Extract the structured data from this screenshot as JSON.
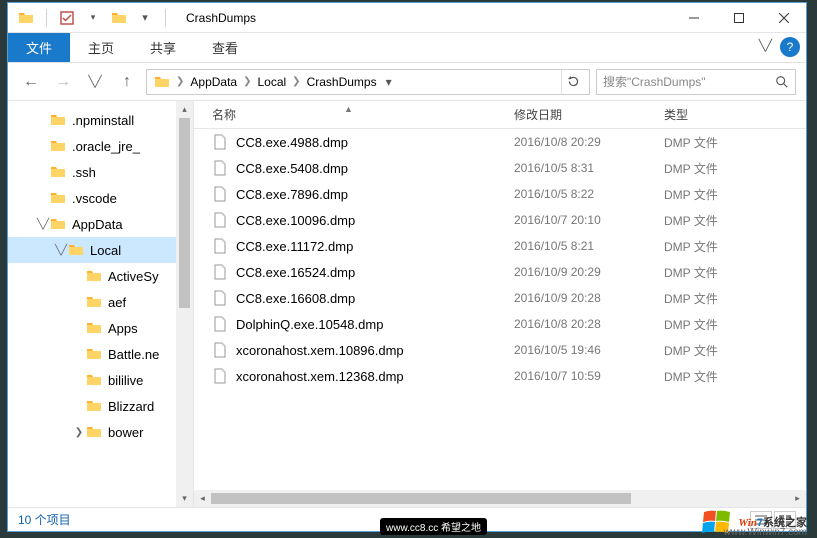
{
  "window": {
    "title": "CrashDumps"
  },
  "ribbon": {
    "file": "文件",
    "tabs": [
      "主页",
      "共享",
      "查看"
    ]
  },
  "breadcrumbs": [
    "AppData",
    "Local",
    "CrashDumps"
  ],
  "search": {
    "placeholder": "搜索\"CrashDumps\""
  },
  "tree": [
    {
      "depth": 1,
      "label": ".npminstall",
      "expand": ""
    },
    {
      "depth": 1,
      "label": ".oracle_jre_",
      "expand": ""
    },
    {
      "depth": 1,
      "label": ".ssh",
      "expand": ""
    },
    {
      "depth": 1,
      "label": ".vscode",
      "expand": ""
    },
    {
      "depth": 1,
      "label": "AppData",
      "expand": "open"
    },
    {
      "depth": 2,
      "label": "Local",
      "expand": "open",
      "selected": true
    },
    {
      "depth": 3,
      "label": "ActiveSy",
      "expand": ""
    },
    {
      "depth": 3,
      "label": "aef",
      "expand": ""
    },
    {
      "depth": 3,
      "label": "Apps",
      "expand": ""
    },
    {
      "depth": 3,
      "label": "Battle.ne",
      "expand": ""
    },
    {
      "depth": 3,
      "label": "bililive",
      "expand": ""
    },
    {
      "depth": 3,
      "label": "Blizzard",
      "expand": ""
    },
    {
      "depth": 3,
      "label": "bower",
      "expand": "closed"
    }
  ],
  "columns": {
    "name": "名称",
    "date": "修改日期",
    "type": "类型"
  },
  "files": [
    {
      "name": "CC8.exe.4988.dmp",
      "date": "2016/10/8 20:29",
      "type": "DMP 文件"
    },
    {
      "name": "CC8.exe.5408.dmp",
      "date": "2016/10/5 8:31",
      "type": "DMP 文件"
    },
    {
      "name": "CC8.exe.7896.dmp",
      "date": "2016/10/5 8:22",
      "type": "DMP 文件"
    },
    {
      "name": "CC8.exe.10096.dmp",
      "date": "2016/10/7 20:10",
      "type": "DMP 文件"
    },
    {
      "name": "CC8.exe.11172.dmp",
      "date": "2016/10/5 8:21",
      "type": "DMP 文件"
    },
    {
      "name": "CC8.exe.16524.dmp",
      "date": "2016/10/9 20:29",
      "type": "DMP 文件"
    },
    {
      "name": "CC8.exe.16608.dmp",
      "date": "2016/10/9 20:28",
      "type": "DMP 文件"
    },
    {
      "name": "DolphinQ.exe.10548.dmp",
      "date": "2016/10/8 20:28",
      "type": "DMP 文件"
    },
    {
      "name": "xcoronahost.xem.10896.dmp",
      "date": "2016/10/5 19:46",
      "type": "DMP 文件"
    },
    {
      "name": "xcoronahost.xem.12368.dmp",
      "date": "2016/10/7 10:59",
      "type": "DMP 文件"
    }
  ],
  "status": {
    "count": "10 个项目"
  },
  "watermark": {
    "brand_w": "W",
    "brand_in": "in",
    "brand_7": "7",
    "brand_suffix": "系统之家",
    "url": "www.Winwin7.com"
  },
  "badge": "www.cc8.cc 希望之地"
}
